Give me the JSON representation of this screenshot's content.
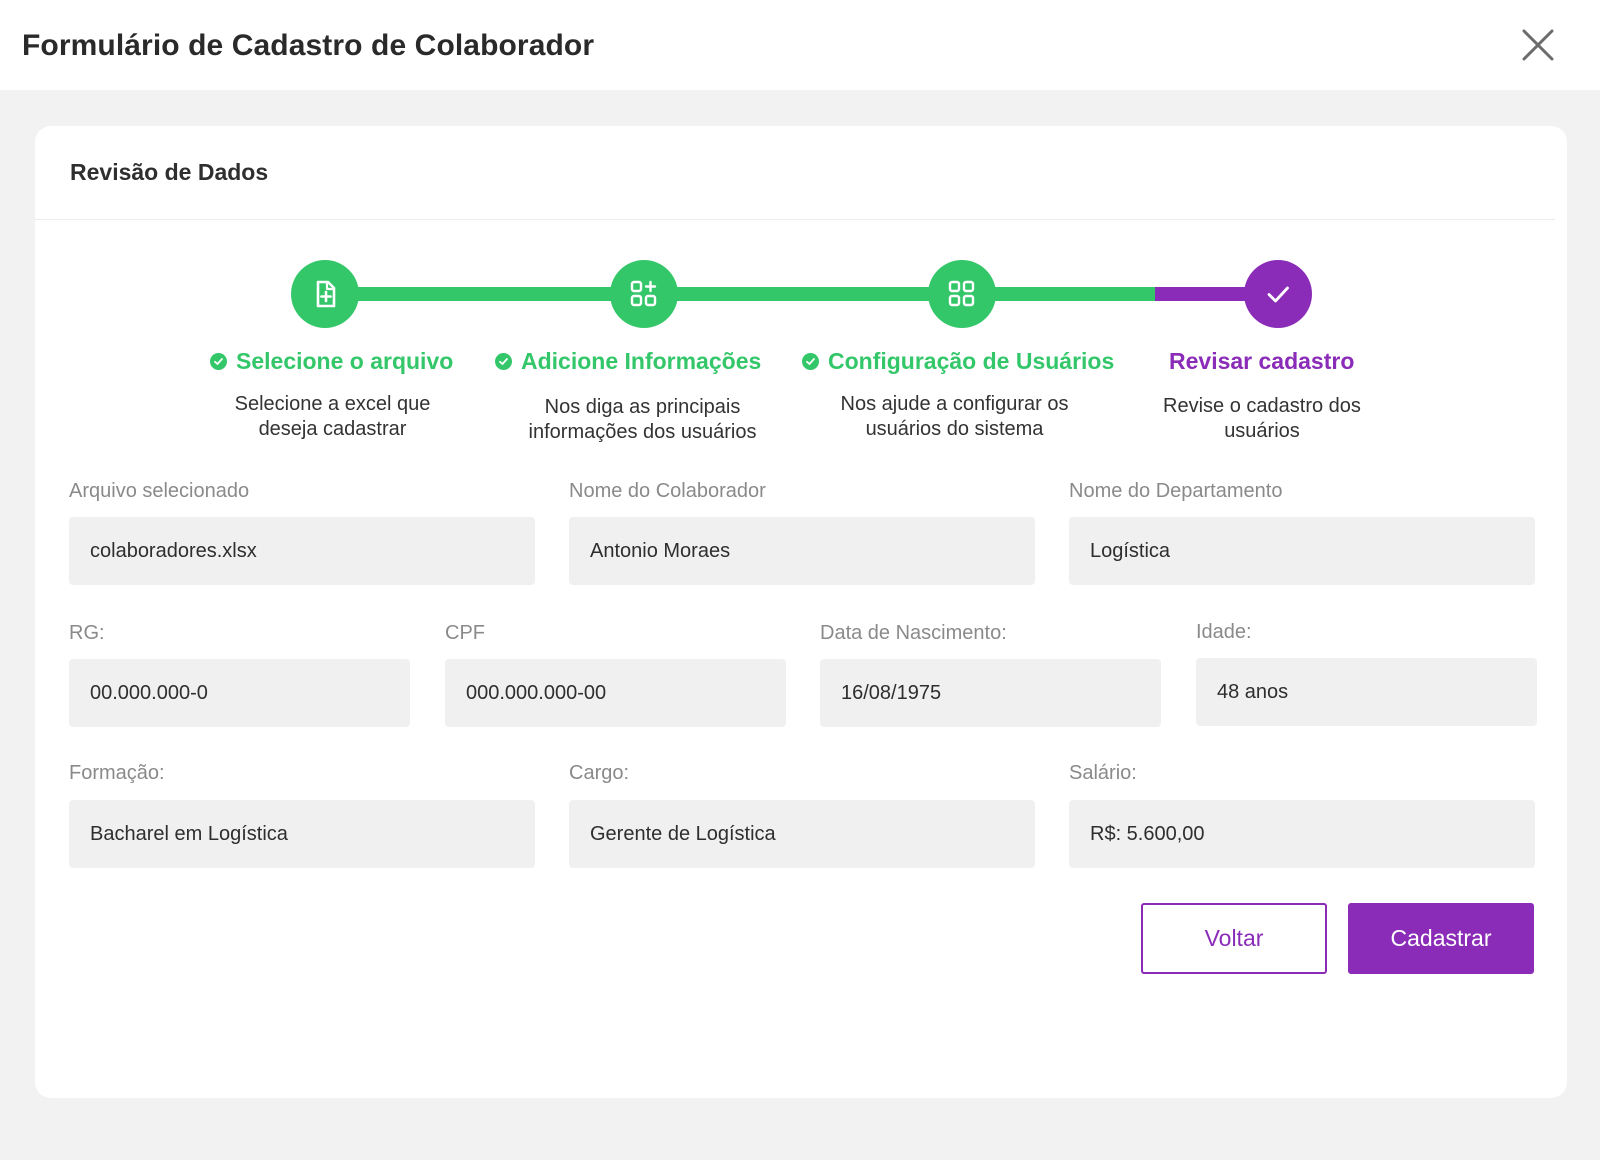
{
  "header": {
    "title": "Formulário de Cadastro de Colaborador"
  },
  "card": {
    "title": "Revisão de Dados"
  },
  "colors": {
    "accent": "#8a2cb8",
    "success": "#34c76a"
  },
  "steps": [
    {
      "title": "Selecione o arquivo",
      "description": "Selecione a excel que deseja cadastrar",
      "status": "completed",
      "icon": "file-plus-icon"
    },
    {
      "title": "Adicione Informações",
      "description": "Nos diga as principais informações dos usuários",
      "status": "completed",
      "icon": "grid-plus-icon"
    },
    {
      "title": "Configuração de Usuários",
      "description": "Nos ajude a configurar os usuários do sistema",
      "status": "completed",
      "icon": "grid-icon"
    },
    {
      "title": "Revisar cadastro",
      "description": "Revise o cadastro dos usuários",
      "status": "current",
      "icon": "check-icon"
    }
  ],
  "fields": {
    "arquivo": {
      "label": "Arquivo selecionado",
      "value": "colaboradores.xlsx"
    },
    "nome": {
      "label": "Nome do Colaborador",
      "value": "Antonio Moraes"
    },
    "departamento": {
      "label": "Nome do Departamento",
      "value": "Logística"
    },
    "rg": {
      "label": "RG:",
      "value": "00.000.000-0"
    },
    "cpf": {
      "label": "CPF",
      "value": "000.000.000-00"
    },
    "nascimento": {
      "label": "Data de Nascimento:",
      "value": "16/08/1975"
    },
    "idade": {
      "label": "Idade:",
      "value": "48 anos"
    },
    "formacao": {
      "label": "Formação:",
      "value": "Bacharel em Logística"
    },
    "cargo": {
      "label": "Cargo:",
      "value": "Gerente de Logística"
    },
    "salario": {
      "label": "Salário:",
      "value": "R$: 5.600,00"
    }
  },
  "buttons": {
    "back": "Voltar",
    "submit": "Cadastrar"
  }
}
